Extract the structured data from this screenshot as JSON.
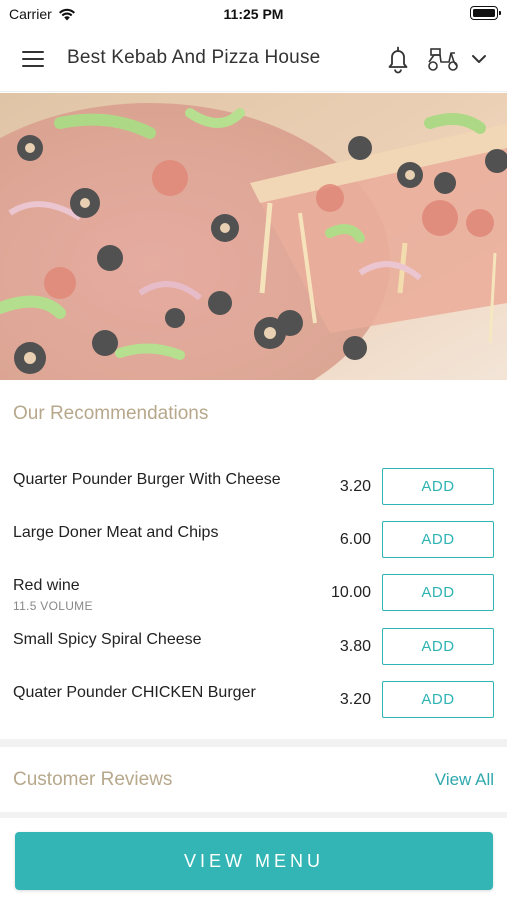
{
  "status_bar": {
    "carrier": "Carrier",
    "time": "11:25 PM"
  },
  "header": {
    "title": "Best Kebab And Pizza House",
    "icons": [
      "hamburger-menu-icon",
      "bell-icon",
      "scooter-delivery-icon",
      "chevron-down-icon"
    ]
  },
  "hero": {
    "image_description_icon": "pizza-photo"
  },
  "recommendations": {
    "title": "Our Recommendations",
    "items": [
      {
        "name": "Quarter Pounder Burger With Cheese",
        "subtitle": "",
        "price": "3.20",
        "add_label": "ADD"
      },
      {
        "name": "Large Doner Meat and Chips",
        "subtitle": "",
        "price": "6.00",
        "add_label": "ADD"
      },
      {
        "name": "Red wine",
        "subtitle": "11.5 VOLUME",
        "price": "10.00",
        "add_label": "ADD"
      },
      {
        "name": "Small Spicy Spiral Cheese",
        "subtitle": "",
        "price": "3.80",
        "add_label": "ADD"
      },
      {
        "name": "Quater Pounder CHICKEN Burger",
        "subtitle": "",
        "price": "3.20",
        "add_label": "ADD"
      }
    ]
  },
  "reviews": {
    "title": "Customer Reviews",
    "view_all": "View All"
  },
  "footer": {
    "view_menu": "VIEW MENU"
  },
  "colors": {
    "accent": "#33b5b5",
    "section_title": "#b7a88c",
    "text": "#222222"
  }
}
